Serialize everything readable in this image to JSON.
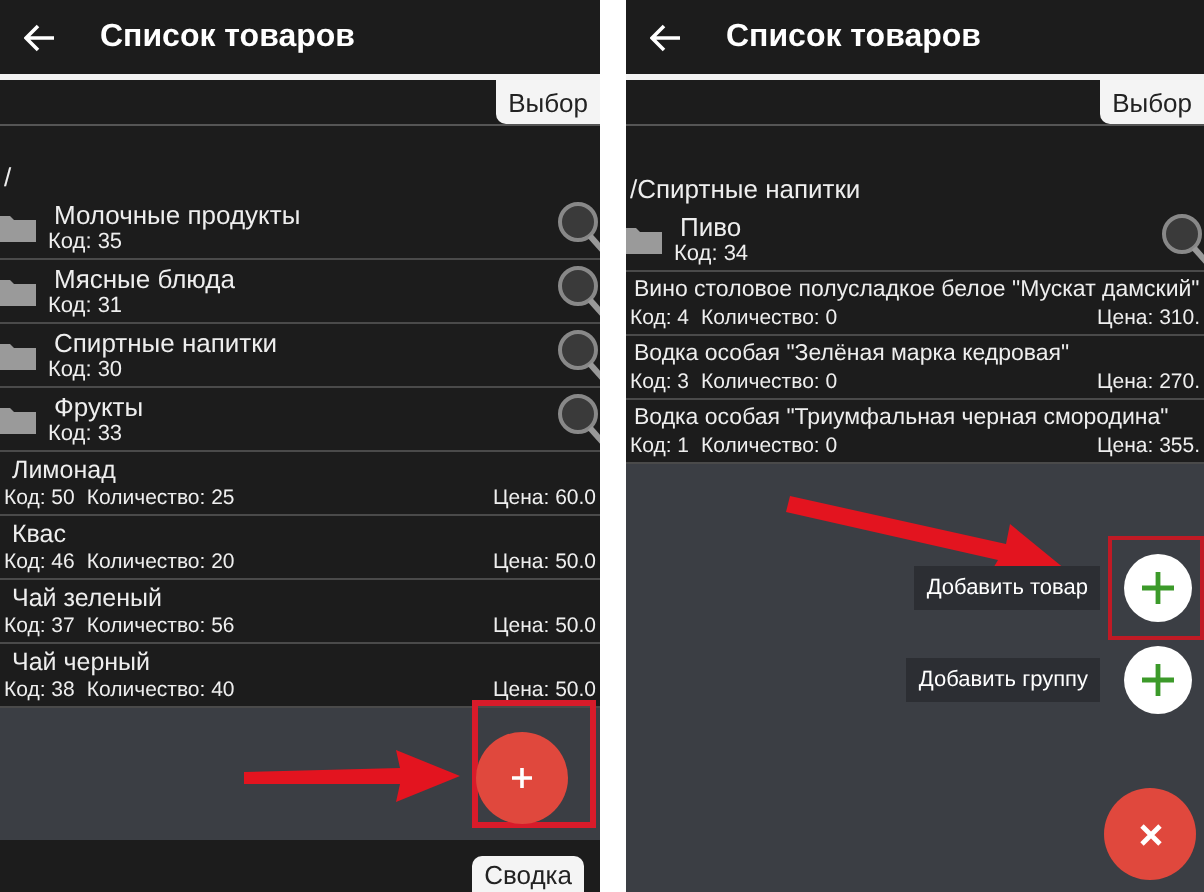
{
  "screens": [
    {
      "title": "Список товаров",
      "tab": "Выбор",
      "path": "/",
      "groups": [
        {
          "name": "Молочные продукты",
          "code": "Код: 35"
        },
        {
          "name": "Мясные блюда",
          "code": "Код: 31"
        },
        {
          "name": "Спиртные напитки",
          "code": "Код: 30"
        },
        {
          "name": "Фрукты",
          "code": "Код: 33"
        }
      ],
      "items": [
        {
          "name": "Лимонад",
          "code": "Код: 50",
          "quantity": "Количество: 25",
          "price": "Цена: 60.0"
        },
        {
          "name": "Квас",
          "code": "Код: 46",
          "quantity": "Количество: 20",
          "price": "Цена: 50.0"
        },
        {
          "name": "Чай зеленый",
          "code": "Код: 37",
          "quantity": "Количество: 56",
          "price": "Цена: 50.0"
        },
        {
          "name": "Чай черный",
          "code": "Код: 38",
          "quantity": "Количество: 40",
          "price": "Цена: 50.0"
        }
      ],
      "fab": {
        "kind": "add",
        "highlighted": true
      },
      "bottom_tab": "Сводка"
    },
    {
      "title": "Список товаров",
      "tab": "Выбор",
      "path": "/Спиртные напитки",
      "groups": [
        {
          "name": "Пиво",
          "code": "Код: 34"
        }
      ],
      "items": [
        {
          "name": "Вино столовое полусладкое белое \"Мускат дамский\"",
          "code": "Код: 4",
          "quantity": "Количество: 0",
          "price": "Цена: 310."
        },
        {
          "name": "Водка особая \"Зелёная марка кедровая\"",
          "code": "Код: 3",
          "quantity": "Количество: 0",
          "price": "Цена: 270."
        },
        {
          "name": "Водка особая \"Триумфальная черная смородина\"",
          "code": "Код: 1",
          "quantity": "Количество: 0",
          "price": "Цена: 355."
        }
      ],
      "actions": [
        {
          "label": "Добавить товар",
          "highlighted": true
        },
        {
          "label": "Добавить группу",
          "highlighted": false
        }
      ],
      "fab": {
        "kind": "close",
        "highlighted": false
      }
    }
  ]
}
